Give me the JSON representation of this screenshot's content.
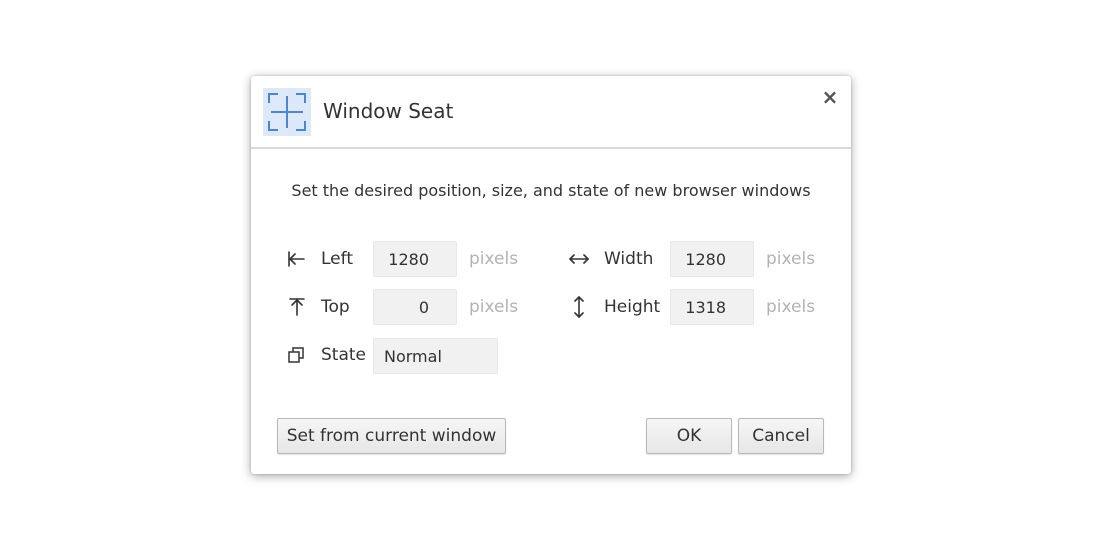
{
  "dialog": {
    "title": "Window Seat",
    "app_icon": "window-seat-crosshair-icon",
    "close_icon": "close-icon",
    "close_glyph": "×",
    "description": "Set the desired position, size, and state of new browser windows",
    "accent_color": "#4a86d6"
  },
  "fields": {
    "left": {
      "icon": "arrow-left-to-bar-icon",
      "label": "Left",
      "value": "1280",
      "unit": "pixels"
    },
    "top": {
      "icon": "arrow-up-to-bar-icon",
      "label": "Top",
      "value": "0",
      "unit": "pixels"
    },
    "width": {
      "icon": "horizontal-resize-icon",
      "label": "Width",
      "value": "1280",
      "unit": "pixels"
    },
    "height": {
      "icon": "vertical-resize-icon",
      "label": "Height",
      "value": "1318",
      "unit": "pixels"
    },
    "state": {
      "icon": "restore-window-icon",
      "label": "State",
      "value": "Normal"
    }
  },
  "buttons": {
    "set_from_current": "Set from current window",
    "ok": "OK",
    "cancel": "Cancel"
  }
}
